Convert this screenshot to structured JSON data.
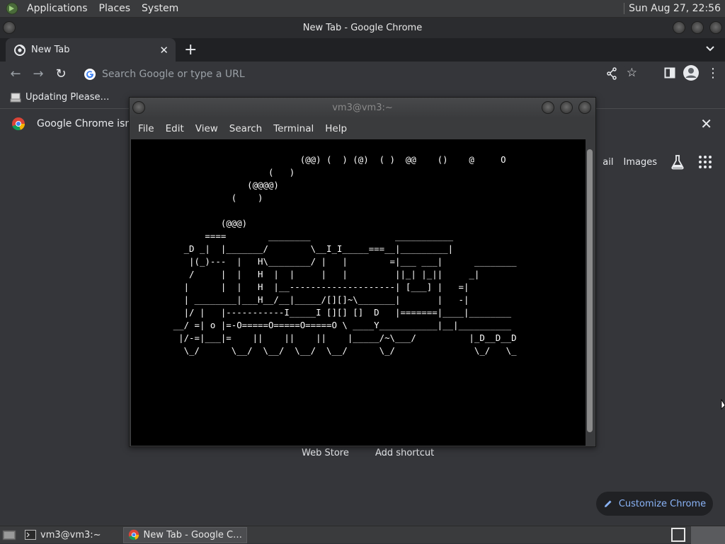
{
  "top_panel": {
    "menus": [
      "Applications",
      "Places",
      "System"
    ],
    "clock": "Sun Aug 27, 22:56"
  },
  "chrome": {
    "window_title": "New Tab - Google Chrome",
    "tab": {
      "title": "New Tab"
    },
    "omnibox": {
      "placeholder": "Search Google or type a URL"
    },
    "bookmark": {
      "label": "Updating Please…"
    },
    "infobar": {
      "text": "Google Chrome isn't"
    },
    "ntp": {
      "gmail_fragment": "ail",
      "images_link": "Images",
      "shortcuts": [
        "Web Store",
        "Add shortcut"
      ],
      "customize": "Customize Chrome"
    }
  },
  "terminal": {
    "title": "vm3@vm3:~",
    "menus": [
      "File",
      "Edit",
      "View",
      "Search",
      "Terminal",
      "Help"
    ],
    "screen_text": "                                (@@) (  ) (@)  ( )  @@    ()    @     O\n                          (   )\n                      (@@@@)\n                   (    )\n\n                 (@@@)\n              ====        ________                ___________\n          _D _|  |_______/        \\__I_I_____===__|_________|\n           |(_)---  |   H\\________/ |   |        =|___ ___|      ________\n           /     |  |   H  |  |     |   |         ||_| |_||     _|\n          |      |  |   H  |__--------------------| [___] |   =|\n          | ________|___H__/__|_____/[][]~\\_______|       |   -|\n          |/ |   |-----------I_____I [][] []  D   |=======|____|________\n        __/ =| o |=-O=====O=====O=====O \\ ____Y___________|__|__________\n         |/-=|___|=    ||    ||    ||    |_____/~\\___/          |_D__D__D\n          \\_/      \\__/  \\__/  \\__/  \\__/      \\_/               \\_/   \\_"
  },
  "taskbar": {
    "items": [
      {
        "label": "vm3@vm3:~",
        "icon": "terminal-icon"
      },
      {
        "label": "New Tab - Google C…",
        "icon": "chrome-icon"
      }
    ]
  },
  "colors": {
    "chrome_bg": "#35363a",
    "tab_strip": "#202124",
    "link_blue": "#8ab4f8",
    "terminal_bg": "#000000"
  }
}
